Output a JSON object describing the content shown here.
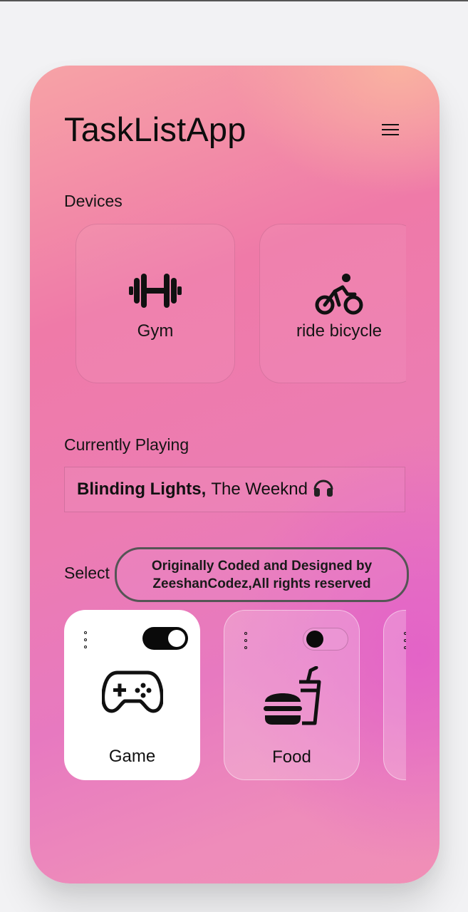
{
  "app": {
    "title": "TaskListApp"
  },
  "sections": {
    "devices": "Devices",
    "currently_playing": "Currently Playing",
    "select": "Select"
  },
  "devices": [
    {
      "label": "Gym",
      "icon": "dumbbell-icon"
    },
    {
      "label": "ride bicycle",
      "icon": "bicycle-icon"
    }
  ],
  "now_playing": {
    "title": "Blinding Lights,",
    "artist": "The Weeknd",
    "icon": "headphones-icon"
  },
  "credit": {
    "line1": "Originally Coded and Designed by",
    "line2": "ZeeshanCodez,All rights reserved"
  },
  "select_cards": [
    {
      "label": "Game",
      "icon": "gamepad-icon",
      "toggle_on": true
    },
    {
      "label": "Food",
      "icon": "fastfood-icon",
      "toggle_on": false
    },
    {
      "label": "",
      "icon": "",
      "toggle_on": false
    }
  ],
  "colors": {
    "gradient_top": "#f7a3a6",
    "gradient_mid": "#ec7cb2",
    "gradient_magenta": "#e260c8",
    "card_active": "#ffffff",
    "toggle_on": "#0a0a0a"
  }
}
